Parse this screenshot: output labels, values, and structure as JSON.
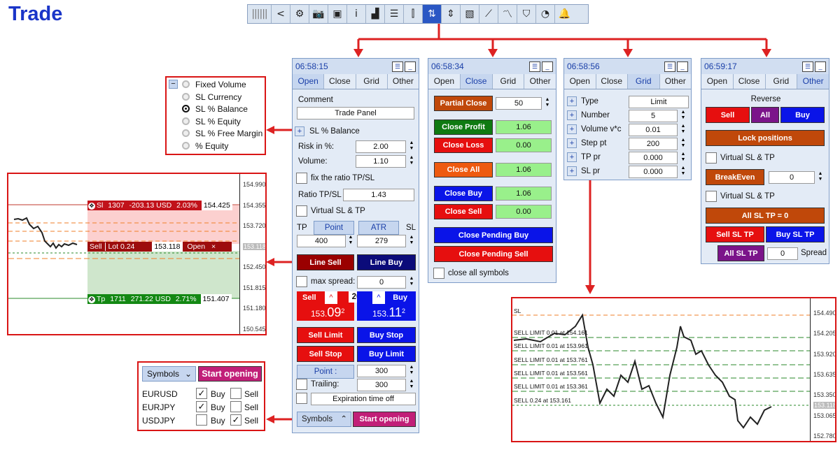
{
  "page_title": "Trade",
  "toolbar": {
    "icons": [
      "grip-icon",
      "back-icon",
      "gear-icon",
      "camera-icon",
      "briefcase-icon",
      "info-icon",
      "signal-icon",
      "list-icon",
      "candles-icon",
      "trade-panel-icon",
      "range-icon",
      "pattern-icon",
      "trend-icon",
      "chart-line-icon",
      "shield-icon",
      "pie-chart-icon",
      "bell-icon"
    ]
  },
  "radio_panel": {
    "toggle": "−",
    "items": [
      "Fixed Volume",
      "SL Currency",
      "SL % Balance",
      "SL % Equity",
      "SL % Free Margin",
      "% Equity"
    ],
    "selected": "SL % Balance"
  },
  "left_chart": {
    "axis": [
      "154.990",
      "154.355",
      "153.720",
      "153.118",
      "152.450",
      "151.815",
      "151.180",
      "150.545"
    ],
    "sl_label": "Sl",
    "sl_points": "1307",
    "sl_money": "-203.13 USD",
    "sl_pct": "2.03%",
    "sl_price": "154.425",
    "order_label": "Sell",
    "order_lot": "Lot 0.24",
    "order_price": "153.118",
    "order_open": "Open",
    "order_close": "×",
    "tp_label": "Tp",
    "tp_points": "1711",
    "tp_money": "271.22 USD",
    "tp_pct": "2.71%",
    "tp_price": "151.407"
  },
  "symbols_panel": {
    "select": "Symbols",
    "start": "Start opening",
    "rows": [
      {
        "symbol": "EURUSD",
        "buy": true,
        "sell": false
      },
      {
        "symbol": "EURJPY",
        "buy": true,
        "sell": false
      },
      {
        "symbol": "USDJPY",
        "buy": false,
        "sell": true
      }
    ],
    "buy_label": "Buy",
    "sell_label": "Sell"
  },
  "open_panel": {
    "time": "06:58:15",
    "tabs": [
      "Open",
      "Close",
      "Grid",
      "Other"
    ],
    "comment_label": "Comment",
    "comment_value": "Trade Panel",
    "sl_mode": "SL % Balance",
    "risk_label": "Risk in %:",
    "risk_value": "2.00",
    "volume_label": "Volume:",
    "volume_value": "1.10",
    "fix_ratio_label": "fix the ratio TP/SL",
    "ratio_label": "Ratio TP/SL",
    "ratio_value": "1.43",
    "virtual_label": "Virtual SL & TP",
    "tp_label": "TP",
    "sl_label": "SL",
    "point_btn": "Point",
    "atr_btn": "ATR",
    "tp_value": "400",
    "sl_value": "279",
    "line_sell": "Line Sell",
    "line_buy": "Line Buy",
    "max_spread_label": "max spread:",
    "max_spread_value": "0",
    "sell_label": "Sell",
    "buy_label": "Buy",
    "spread": "20",
    "sell_price_a": "153.",
    "sell_price_b": "09",
    "sell_price_c": "2",
    "buy_price_a": "153.",
    "buy_price_b": "11",
    "buy_price_c": "2",
    "sell_limit": "Sell Limit",
    "buy_stop": "Buy Stop",
    "sell_stop": "Sell Stop",
    "buy_limit": "Buy Limit",
    "point_field": "Point :",
    "point_value": "300",
    "trailing_label": "Trailing:",
    "trailing_value": "300",
    "expiration": "Expiration time off",
    "symbols_select": "Symbols",
    "start_opening": "Start opening"
  },
  "close_panel": {
    "time": "06:58:34",
    "tabs": [
      "Open",
      "Close",
      "Grid",
      "Other"
    ],
    "partial_close": "Partial Close",
    "partial_value": "50",
    "close_profit": "Close Profit",
    "close_profit_value": "1.06",
    "close_loss": "Close Loss",
    "close_loss_value": "0.00",
    "close_all": "Close All",
    "close_all_value": "1.06",
    "close_buy": "Close Buy",
    "close_buy_value": "1.06",
    "close_sell": "Close Sell",
    "close_sell_value": "0.00",
    "close_pending_buy": "Close Pending Buy",
    "close_pending_sell": "Close Pending Sell",
    "close_all_symbols": "close all symbols"
  },
  "grid_panel": {
    "time": "06:58:56",
    "tabs": [
      "Open",
      "Close",
      "Grid",
      "Other"
    ],
    "rows": [
      {
        "label": "Type",
        "value": "Limit"
      },
      {
        "label": "Number",
        "value": "5"
      },
      {
        "label": "Volume v*c",
        "value": "0.01"
      },
      {
        "label": "Step pt",
        "value": "200"
      },
      {
        "label": "TP pr",
        "value": "0.000"
      },
      {
        "label": "SL pr",
        "value": "0.000"
      }
    ]
  },
  "other_panel": {
    "time": "06:59:17",
    "tabs": [
      "Open",
      "Close",
      "Grid",
      "Other"
    ],
    "reverse": "Reverse",
    "sell": "Sell",
    "all": "All",
    "buy": "Buy",
    "lock": "Lock positions",
    "virtual1": "Virtual SL & TP",
    "breakeven": "BreakEven",
    "breakeven_value": "0",
    "virtual2": "Virtual SL & TP",
    "all_sl_tp": "All SL TP = 0",
    "sell_sl_tp": "Sell SL TP",
    "buy_sl_tp": "Buy SL TP",
    "all_sl_tp2": "All SL TP",
    "spread_value": "0",
    "spread_label": "Spread"
  },
  "right_chart": {
    "axis": [
      "154.490",
      "154.205",
      "153.920",
      "153.635",
      "153.350",
      "153.118",
      "153.065",
      "152.780"
    ],
    "sl_label": "SL",
    "lines": [
      "SELL LIMIT 0.01 at 154.161",
      "SELL LIMIT 0.01 at 153.961",
      "SELL LIMIT 0.01 at 153.761",
      "SELL LIMIT 0.01 at 153.561",
      "SELL LIMIT 0.01 at 153.361",
      "SELL 0.24 at 153.161"
    ]
  },
  "colors": {
    "accent": "#1a35c8",
    "arrow": "#dd2222",
    "sell": "#e60f0f",
    "buy": "#0a14e8"
  }
}
